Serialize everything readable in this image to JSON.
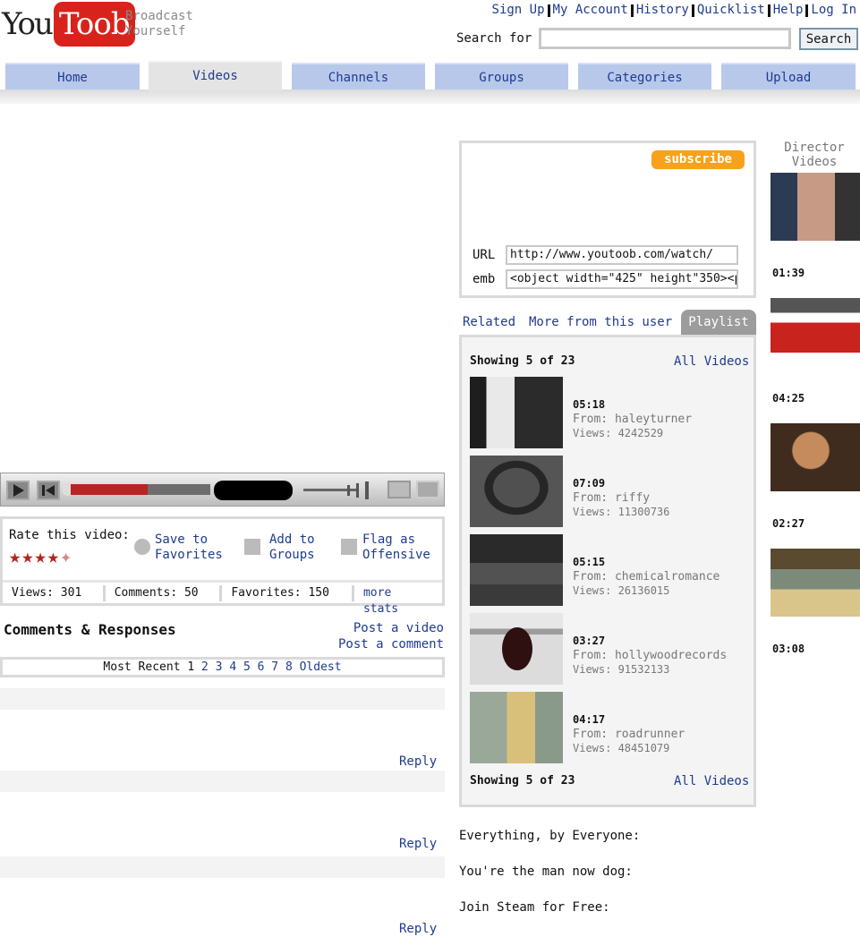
{
  "header": {
    "logo_you": "You",
    "logo_toob": "Toob",
    "tagline": "Broadcast Yourself",
    "links": [
      "Sign Up",
      "My Account",
      "History",
      "Quicklist",
      "Help",
      "Log In"
    ],
    "search_label": "Search for",
    "search_value": "",
    "search_button": "Search"
  },
  "nav": {
    "tabs": [
      "Home",
      "Videos",
      "Channels",
      "Groups",
      "Categories",
      "Upload"
    ],
    "active": "Videos"
  },
  "rating": {
    "label": "Rate this video:",
    "stars": 4.5,
    "save": "Save to Favorites",
    "add": "Add to Groups",
    "flag": "Flag as Offensive"
  },
  "stats": {
    "views": "Views: 301",
    "comments": "Comments: 50",
    "favorites": "Favorites: 150",
    "more": "more stats"
  },
  "comments": {
    "heading": "Comments & Responses",
    "post_video": "Post a video",
    "post_comment": "Post a comment",
    "pager_prefix": "Most Recent",
    "current_page": "1",
    "pages": [
      "2",
      "3",
      "4",
      "5",
      "6",
      "7",
      "8"
    ],
    "oldest": "Oldest",
    "reply": "Reply"
  },
  "info": {
    "subscribe": "subscribe",
    "url_label": "URL",
    "url_value": "http://www.youtoob.com/watch/",
    "embed_label": "emb",
    "embed_value": "<object width=\"425\" height\"350><p"
  },
  "playlist": {
    "tab_related": "Related",
    "tab_more": "More from this user",
    "tab_playlist": "Playlist",
    "showing": "Showing 5 of 23",
    "all_videos": "All Videos",
    "items": [
      {
        "duration": "05:18",
        "from": "From: haleyturner",
        "views": "Views: 4242529"
      },
      {
        "duration": "07:09",
        "from": "From: riffy",
        "views": "Views: 11300736"
      },
      {
        "duration": "05:15",
        "from": "From: chemicalromance",
        "views": "Views: 26136015"
      },
      {
        "duration": "03:27",
        "from": "From: hollywoodrecords",
        "views": "Views: 91532133"
      },
      {
        "duration": "04:17",
        "from": "From: roadrunner",
        "views": "Views: 48451079"
      }
    ]
  },
  "promos": [
    "Everything, by Everyone:",
    "You're the man now dog:",
    "Join Steam for Free:"
  ],
  "director": {
    "heading": "Director Videos",
    "durations": [
      "01:39",
      "04:25",
      "02:27",
      "03:08"
    ]
  },
  "colors": {
    "brand_red": "#d8231c",
    "link_blue": "#1f3b8f",
    "nav_blue": "#b7c8ea",
    "subscribe_orange": "#f7a11c"
  }
}
